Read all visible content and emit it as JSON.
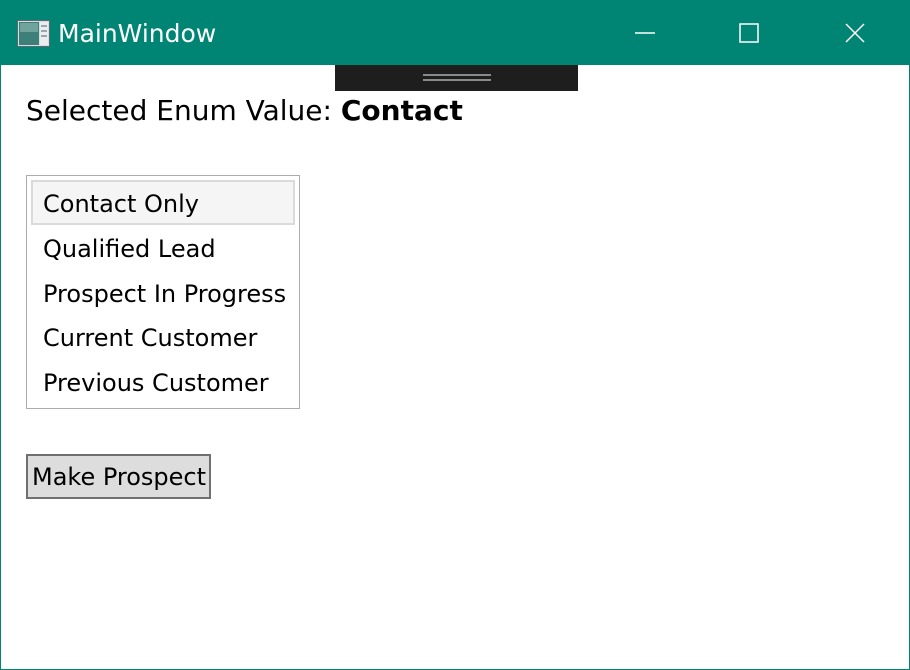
{
  "window": {
    "title": "MainWindow",
    "accent_color": "#008575",
    "icons": {
      "app": "app-window-icon",
      "minimize": "minimize-icon",
      "maximize": "maximize-icon",
      "close": "close-icon"
    }
  },
  "main": {
    "selected_prefix": "Selected Enum Value: ",
    "selected_value": "Contact",
    "list": {
      "selected_index": 0,
      "items": [
        {
          "label": "Contact Only"
        },
        {
          "label": "Qualified Lead"
        },
        {
          "label": "Prospect In Progress"
        },
        {
          "label": "Current Customer"
        },
        {
          "label": "Previous Customer"
        }
      ]
    },
    "button_label": "Make Prospect"
  }
}
